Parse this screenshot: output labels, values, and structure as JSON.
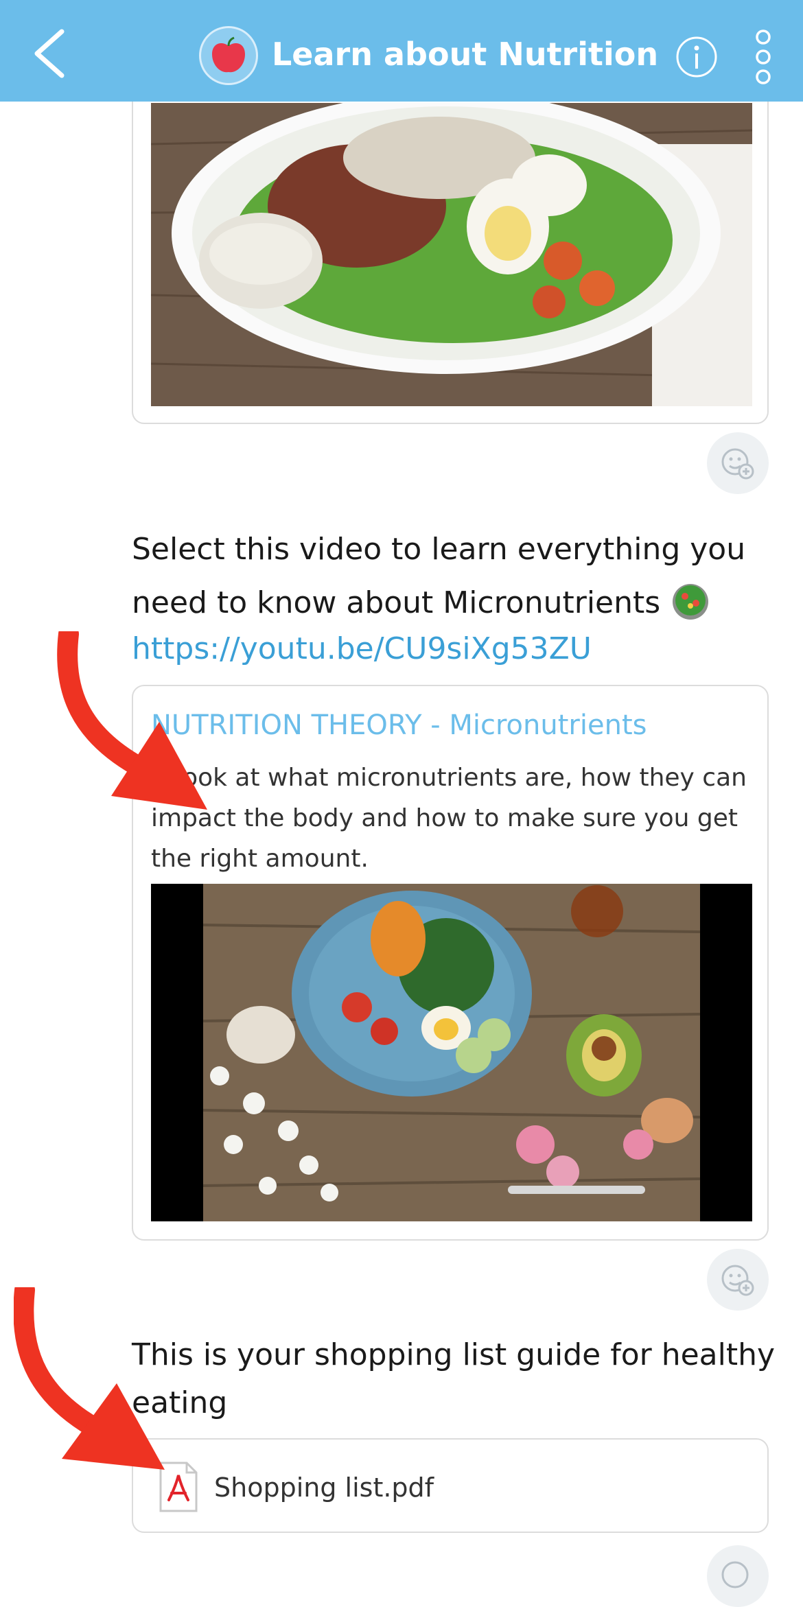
{
  "header": {
    "title": "Learn about Nutrition",
    "background_color": "#6bbdea",
    "avatar_icon": "apple-icon",
    "back_icon": "chevron-left-icon",
    "info_icon": "info-icon",
    "more_icon": "more-vertical-icon"
  },
  "messages": [
    {
      "type": "image",
      "image_description": "salad-photo",
      "reaction_icon": "add-reaction-icon"
    },
    {
      "type": "text-with-link",
      "text": "Select this video to learn everything you need to know about Micronutrients",
      "emoji": "salad-emoji",
      "link": "https://youtu.be/CU9siXg53ZU",
      "preview": {
        "title": "NUTRITION THEORY - Micronutrients",
        "description": "A look at what micronutrients are, how they can impact the body and how to make sure you get the right amount.",
        "thumbnail": "healthy-plate-photo"
      },
      "reaction_icon": "add-reaction-icon"
    },
    {
      "type": "file",
      "text": "This is your shopping list guide for healthy eating",
      "file_name": "Shopping list.pdf",
      "file_icon": "pdf-icon"
    }
  ],
  "colors": {
    "link": "#3a9fd6",
    "preview_title": "#6bbdea",
    "annotation_arrow": "#ee3322"
  }
}
